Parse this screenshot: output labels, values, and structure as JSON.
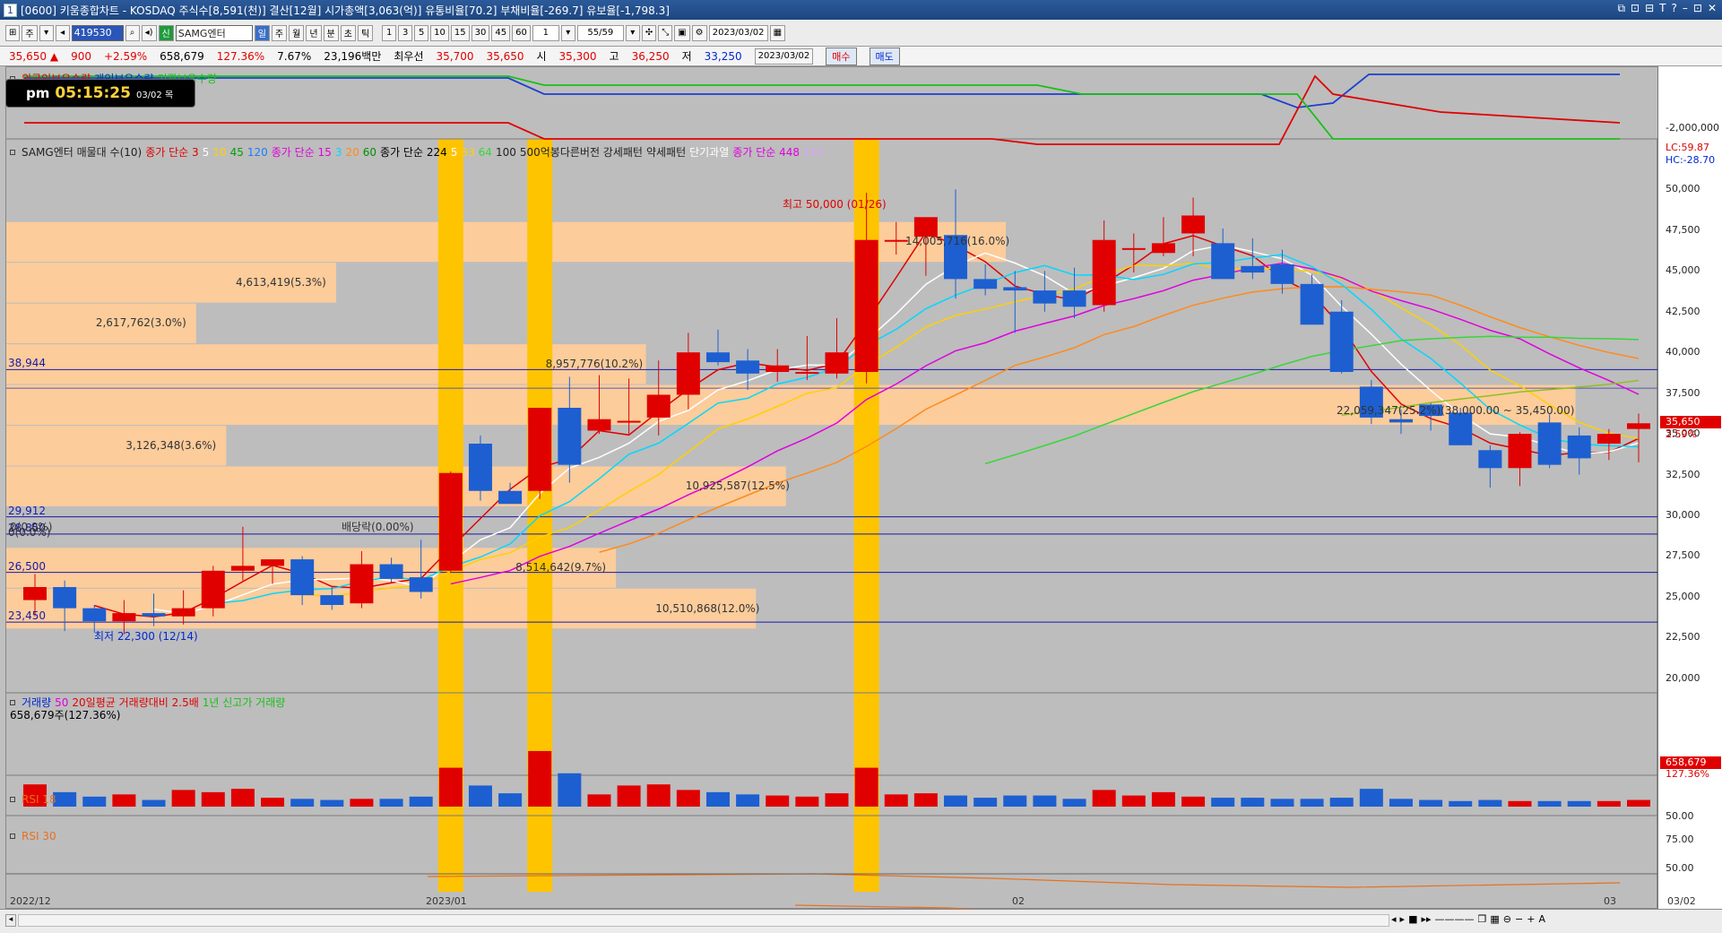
{
  "title": {
    "num": "1",
    "text": "[0600] 키움종합차트 - KOSDAQ 주식수[8,591(천)] 결산[12월] 시가총액[3,063(억)] 유통비율[70.2] 부채비율[-269.7] 유보율[-1,798.3]"
  },
  "window_controls": [
    "⧉",
    "⊡",
    "⊟",
    "T",
    "?",
    "–",
    "⊡",
    "✕"
  ],
  "toolbar": {
    "period": "주",
    "stock_code": "419530",
    "stock_name": "SAMG엔터",
    "tabs": [
      "일",
      "주",
      "월",
      "년",
      "분",
      "초",
      "틱"
    ],
    "active_tab": "일",
    "minutes": [
      "1",
      "3",
      "5",
      "10",
      "15",
      "30",
      "45",
      "60"
    ],
    "count": "1",
    "range": "55/59",
    "date": "2023/03/02"
  },
  "quote": {
    "price": "35,650",
    "change": "900",
    "change_pct": "+2.59%",
    "volume": "658,679",
    "vol_ratio": "127.36%",
    "turnover": "7.67%",
    "amount": "23,196백만",
    "best_label": "최우선",
    "best_ask": "35,700",
    "best_bid": "35,650",
    "open_label": "시",
    "open": "35,300",
    "high_label": "고",
    "high": "36,250",
    "low_label": "저",
    "low": "33,250",
    "buy": "매수",
    "sell": "매도"
  },
  "clock": {
    "ampm": "pm",
    "time": "05:15:25",
    "date": "03/02 목"
  },
  "legends": {
    "investors": [
      {
        "text": "외국인보유수량",
        "color": "#e00000"
      },
      {
        "text": "개인보유수량",
        "color": "#0028d0"
      },
      {
        "text": "기관보유수량",
        "color": "#18c018"
      }
    ],
    "price": [
      {
        "text": "SAMG엔터 매물대 수(10)",
        "color": "#222222"
      },
      {
        "text": "종가 단순 3",
        "color": "#e00000"
      },
      {
        "text": "5",
        "color": "#ffffff"
      },
      {
        "text": "10",
        "color": "#ffd000"
      },
      {
        "text": "45",
        "color": "#00a000"
      },
      {
        "text": "120",
        "color": "#1c7cff"
      },
      {
        "text": "종가 단순 15",
        "color": "#e000e0"
      },
      {
        "text": "3",
        "color": "#00d8ff"
      },
      {
        "text": "20",
        "color": "#ff8a1c"
      },
      {
        "text": "60",
        "color": "#009000"
      },
      {
        "text": "종가 단순 224",
        "color": "#000000"
      },
      {
        "text": "5",
        "color": "#ffffff"
      },
      {
        "text": "33",
        "color": "#ffd000"
      },
      {
        "text": "64",
        "color": "#39d639"
      },
      {
        "text": "100",
        "color": "#222222"
      },
      {
        "text": "500억봉다른버전 강세패턴",
        "color": "#222222"
      },
      {
        "text": "약세패턴",
        "color": "#222222"
      },
      {
        "text": "단기과열",
        "color": "#ffffff"
      },
      {
        "text": "종가 단순 448",
        "color": "#e000e0"
      },
      {
        "text": "112",
        "color": "#d8a0ff"
      }
    ],
    "volume": [
      {
        "text": "거래량",
        "color": "#0028d0"
      },
      {
        "text": "50",
        "color": "#e000e0"
      },
      {
        "text": "20일평균 거래량대비 2.5배",
        "color": "#e00000"
      },
      {
        "text": "1년 신고가 거래량",
        "color": "#18c018"
      }
    ],
    "volume_value": "658,679주(127.36%)",
    "rsi18": "RSI 18",
    "rsi30": "RSI 30"
  },
  "yaxis": {
    "investor": "-2,000,000",
    "lc": "LC:59.87",
    "hc": "HC:-28.70",
    "price_ticks": [
      "50,000",
      "47,500",
      "45,000",
      "42,500",
      "40,000",
      "37,500",
      "35,000",
      "32,500",
      "30,000",
      "27,500",
      "25,000",
      "22,500",
      "20,000"
    ],
    "current_price": "35,650",
    "current_pct": "2.59%",
    "volume_badge": "658,679",
    "volume_pct": "127.36%",
    "rsi18_tick": "50.00",
    "rsi30_tick1": "75.00",
    "rsi30_tick2": "50.00"
  },
  "xaxis": [
    "2022/12",
    "2023/01",
    "02",
    "03",
    "03/02"
  ],
  "levels": [
    {
      "label": "38,944",
      "value": 38944
    },
    {
      "label": "29,912",
      "value": 29912
    },
    {
      "label": "28,850",
      "value": 28850
    },
    {
      "label": "26,500",
      "value": 26500
    },
    {
      "label": "23,450",
      "value": 23450
    }
  ],
  "annotations": {
    "high": "최고 50,000 (01/26)",
    "low": "최저 22,300 (12/14)",
    "dividend": "배당락(0.00%)",
    "zero": "0(0.0%)",
    "range": "22,059,347(25.2%)(38,000.00 ~ 35,450.00)"
  },
  "chart_data": {
    "type": "candlestick",
    "y_range": [
      19000,
      52000
    ],
    "volume_profile": [
      {
        "lo": 45500,
        "hi": 48000,
        "label": "14,005,716(16.0%)",
        "frac": 1.0
      },
      {
        "lo": 43000,
        "hi": 45500,
        "label": "4,613,419(5.3%)",
        "frac": 0.33
      },
      {
        "lo": 40500,
        "hi": 43000,
        "label": "2,617,762(3.0%)",
        "frac": 0.19
      },
      {
        "lo": 38000,
        "hi": 40500,
        "label": "8,957,776(10.2%)",
        "frac": 0.64
      },
      {
        "lo": 35500,
        "hi": 38000,
        "label": "22,059,347(25.2%)",
        "frac": 1.57
      },
      {
        "lo": 33000,
        "hi": 35500,
        "label": "3,126,348(3.6%)",
        "frac": 0.22
      },
      {
        "lo": 30500,
        "hi": 33000,
        "label": "10,925,587(12.5%)",
        "frac": 0.78
      },
      {
        "lo": 28000,
        "hi": 30500,
        "label": "0(0.0%)",
        "frac": 0
      },
      {
        "lo": 25500,
        "hi": 28000,
        "label": "8,514,642(9.7%)",
        "frac": 0.61
      },
      {
        "lo": 23000,
        "hi": 25500,
        "label": "10,510,868(12.0%)",
        "frac": 0.75
      }
    ],
    "candles": [
      [
        24800,
        26400,
        23800,
        25600,
        3
      ],
      [
        25600,
        26000,
        22900,
        24300,
        3
      ],
      [
        24300,
        24500,
        22800,
        23500,
        1
      ],
      [
        23500,
        24800,
        22700,
        24000,
        2
      ],
      [
        24000,
        25200,
        23200,
        23800,
        1
      ],
      [
        23800,
        25400,
        23300,
        24300,
        3
      ],
      [
        24300,
        26900,
        23800,
        26600,
        2
      ],
      [
        26600,
        29300,
        26000,
        26900,
        1
      ],
      [
        26900,
        27200,
        25800,
        27300,
        2
      ],
      [
        27300,
        27500,
        24500,
        25100,
        1
      ],
      [
        25100,
        25600,
        24200,
        24500,
        2
      ],
      [
        24600,
        27800,
        24300,
        27000,
        1
      ],
      [
        27000,
        27400,
        25900,
        26100,
        2
      ],
      [
        26200,
        28500,
        24900,
        25300,
        1
      ],
      [
        26600,
        32700,
        26500,
        32600,
        5
      ],
      [
        34400,
        34900,
        30900,
        31500,
        2
      ],
      [
        31500,
        32000,
        30800,
        30700,
        1
      ],
      [
        31500,
        36500,
        31000,
        36600,
        6
      ],
      [
        36600,
        38500,
        32000,
        33100,
        4
      ],
      [
        35200,
        38600,
        35000,
        35900,
        3
      ],
      [
        35800,
        38400,
        35000,
        35800,
        2
      ],
      [
        36000,
        39500,
        34900,
        37400,
        3
      ],
      [
        37400,
        41200,
        36500,
        40000,
        3
      ],
      [
        40000,
        41400,
        39200,
        39400,
        2
      ],
      [
        39500,
        40200,
        37700,
        38700,
        2
      ],
      [
        38800,
        40200,
        38200,
        39200,
        2
      ],
      [
        38700,
        41000,
        38300,
        38800,
        1
      ],
      [
        38700,
        42100,
        38400,
        40000,
        3
      ],
      [
        38800,
        49800,
        38100,
        46900,
        7
      ],
      [
        46900,
        48000,
        46000,
        46900,
        1
      ],
      [
        47100,
        48000,
        44700,
        48300,
        2
      ],
      [
        47200,
        50000,
        43300,
        44500,
        3
      ],
      [
        44500,
        45400,
        43500,
        43900,
        2
      ],
      [
        44000,
        45000,
        41200,
        43800,
        1
      ],
      [
        43800,
        45000,
        42500,
        43000,
        2
      ],
      [
        43800,
        45200,
        42100,
        42800,
        1
      ],
      [
        42900,
        48100,
        42500,
        46900,
        3
      ],
      [
        46400,
        47300,
        44900,
        46400,
        2
      ],
      [
        46100,
        48300,
        45900,
        46700,
        2
      ],
      [
        47300,
        49500,
        45900,
        48400,
        1
      ],
      [
        46700,
        47600,
        44600,
        44500,
        2
      ],
      [
        45300,
        47000,
        44500,
        44900,
        1
      ],
      [
        45400,
        46300,
        43600,
        44200,
        2
      ],
      [
        44200,
        44800,
        41700,
        41700,
        1
      ],
      [
        42500,
        43200,
        38700,
        38800,
        2
      ],
      [
        37900,
        38300,
        35600,
        36000,
        1
      ],
      [
        35900,
        36500,
        35000,
        35700,
        1
      ],
      [
        36800,
        36900,
        35200,
        36100,
        1
      ],
      [
        36300,
        36600,
        34400,
        34300,
        2
      ],
      [
        34000,
        34300,
        31700,
        32900,
        1
      ],
      [
        32900,
        35100,
        31800,
        35000,
        1
      ],
      [
        35700,
        36200,
        32900,
        33100,
        1
      ],
      [
        34900,
        35400,
        32500,
        33500,
        1
      ],
      [
        34400,
        35300,
        33400,
        35000,
        1
      ],
      [
        35300,
        36250,
        33250,
        35650,
        1
      ]
    ],
    "volume_levels": [
      2,
      1.3,
      0.9,
      1.1,
      0.6,
      1.5,
      1.3,
      1.6,
      0.8,
      0.7,
      0.6,
      0.7,
      0.7,
      0.9,
      3.5,
      1.9,
      1.2,
      5.0,
      3.0,
      1.1,
      1.9,
      2.0,
      1.5,
      1.3,
      1.1,
      1.0,
      0.9,
      1.2,
      3.5,
      1.1,
      1.2,
      1.0,
      0.8,
      1.0,
      1.0,
      0.7,
      1.5,
      1.0,
      1.3,
      0.9,
      0.8,
      0.8,
      0.7,
      0.7,
      0.8,
      1.6,
      0.7,
      0.6,
      0.5,
      0.6,
      0.5,
      0.5,
      0.5,
      0.5,
      0.6
    ],
    "vertical_highlights": [
      14,
      17,
      28
    ],
    "first_x": 1821
  }
}
